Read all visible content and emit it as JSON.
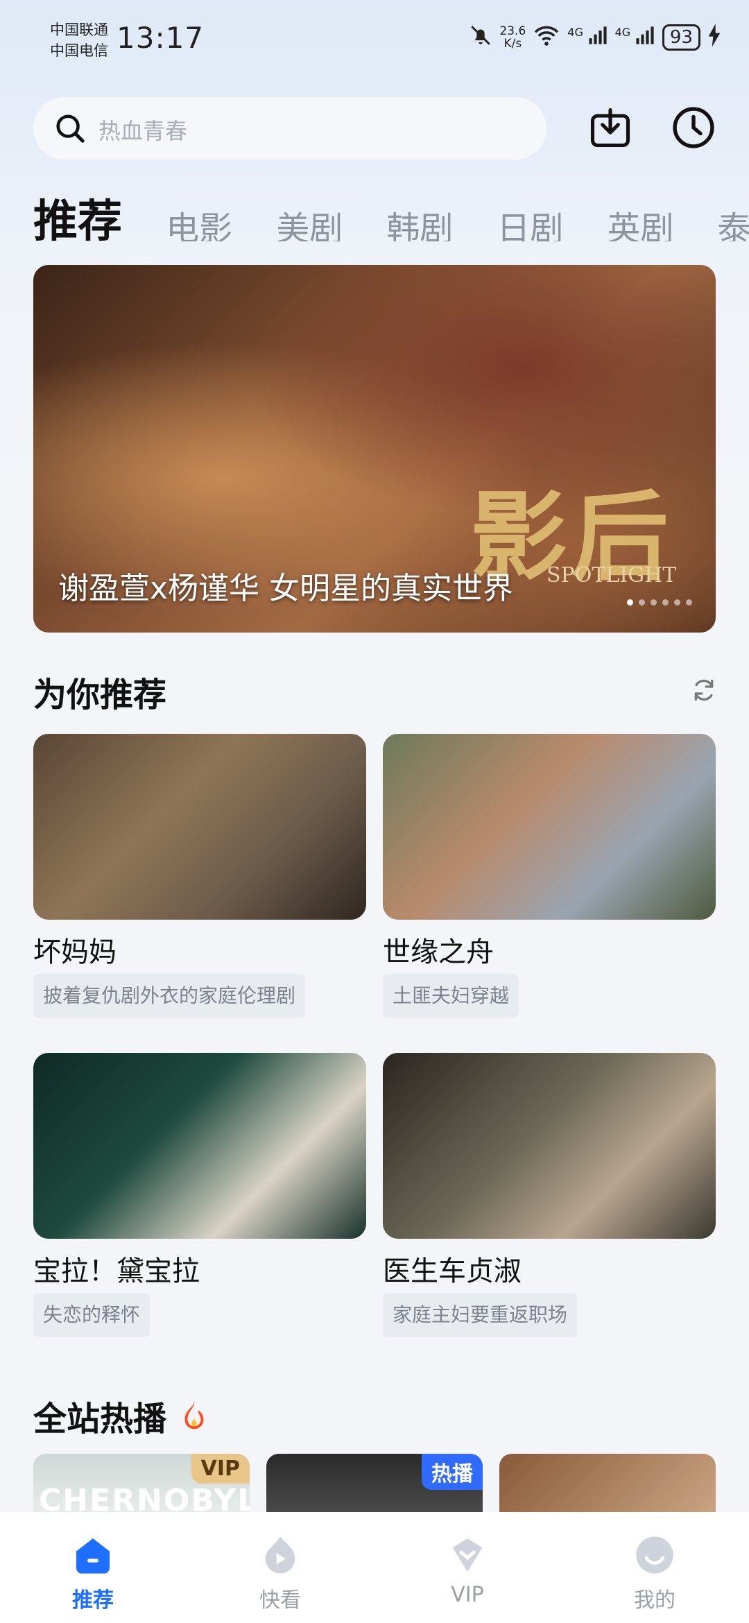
{
  "status_bar": {
    "carrier_1": "中国联通",
    "carrier_2": "中国电信",
    "time": "13:17",
    "net_speed_value": "23.6",
    "net_speed_unit": "K/s",
    "signal_1": "4G",
    "signal_2": "4G",
    "battery": "93"
  },
  "search": {
    "placeholder": "热血青春"
  },
  "tabs": [
    "推荐",
    "电影",
    "美剧",
    "韩剧",
    "日剧",
    "英剧",
    "泰"
  ],
  "banner": {
    "caption": "谢盈萱x杨谨华 女明星的真实世界",
    "logo": "影后",
    "logo_en": "SPOTLIGHT",
    "active_dot": 0
  },
  "recommend": {
    "title": "为你推荐",
    "cards": [
      {
        "title": "坏妈妈",
        "tag": "披着复仇剧外衣的家庭伦理剧"
      },
      {
        "title": "世缘之舟",
        "tag": "土匪夫妇穿越"
      },
      {
        "title": "宝拉！黛宝拉",
        "tag": "失恋的释怀"
      },
      {
        "title": "医生车贞淑",
        "tag": "家庭主妇要重返职场"
      }
    ]
  },
  "hot": {
    "title": "全站热播",
    "items": [
      {
        "poster_text": "CHERNOBYL",
        "badge": "VIP"
      },
      {
        "badge": "热播"
      },
      {}
    ]
  },
  "bottom_nav": [
    {
      "label": "推荐",
      "icon": "home-icon",
      "active": true
    },
    {
      "label": "快看",
      "icon": "play-icon",
      "active": false
    },
    {
      "label": "VIP",
      "icon": "vip-diamond-icon",
      "active": false
    },
    {
      "label": "我的",
      "icon": "profile-icon",
      "active": false
    }
  ],
  "colors": {
    "accent": "#1e6fff",
    "vip_badge": "#e8c68a",
    "hot_badge": "#2f6bff"
  }
}
